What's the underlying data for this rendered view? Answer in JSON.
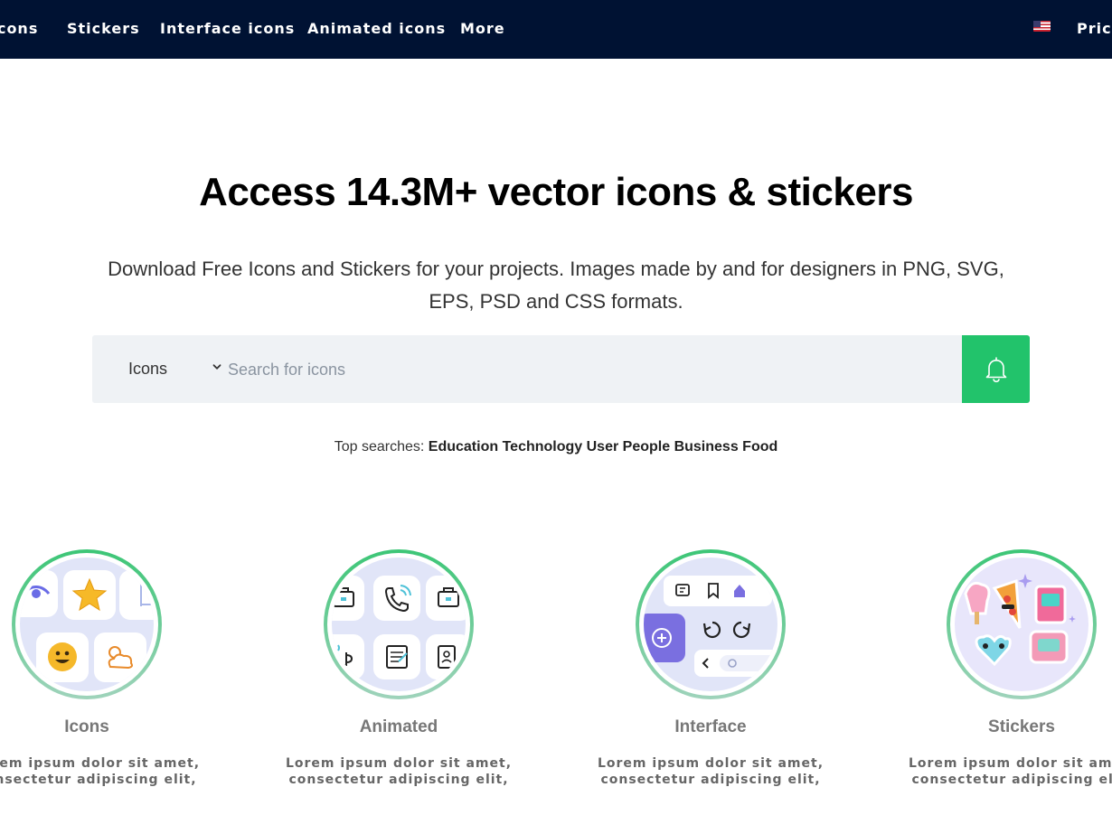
{
  "nav": {
    "items": [
      "Icons",
      "Stickers",
      "Interface icons",
      "Animated icons",
      "More"
    ],
    "pricing": "Pricing",
    "flag": "us-flag-icon"
  },
  "hero": {
    "title": "Access 14.3M+ vector icons & stickers",
    "subtitle": "Download Free Icons and Stickers for your projects. Images made by and for designers in PNG, SVG, EPS, PSD and CSS formats."
  },
  "search": {
    "type_label": "Icons",
    "placeholder": "Search for icons",
    "button_icon": "bell-icon"
  },
  "top_searches": {
    "label": "Top searches:",
    "terms": [
      "Education",
      "Technology",
      "User",
      "People",
      "Business",
      "Food"
    ]
  },
  "categories": [
    {
      "title": "Icons",
      "desc_line1": "Lorem ipsum dolor sit amet,",
      "desc_line2": "consectetur adipiscing elit,"
    },
    {
      "title": "Animated",
      "desc_line1": "Lorem ipsum dolor sit amet,",
      "desc_line2": "consectetur adipiscing elit,"
    },
    {
      "title": "Interface",
      "desc_line1": "Lorem ipsum dolor sit amet,",
      "desc_line2": "consectetur adipiscing elit,"
    },
    {
      "title": "Stickers",
      "desc_line1": "Lorem ipsum dolor sit amet,",
      "desc_line2": "consectetur adipiscing elit,"
    }
  ],
  "colors": {
    "nav_bg": "#001233",
    "accent_green": "#22c36b",
    "search_bg": "#eff2f5"
  }
}
